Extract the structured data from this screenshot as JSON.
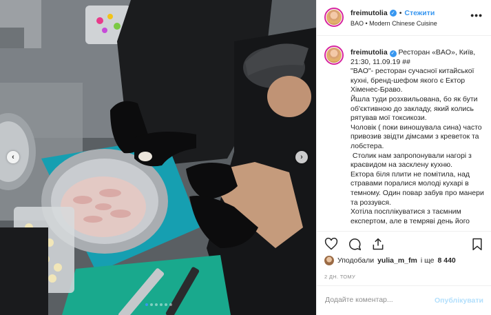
{
  "post": {
    "username": "freimutolia",
    "follow_label": "Стежити",
    "separator": "•",
    "location": "BAO • Modern Chinese Cuisine",
    "more_label": "•••",
    "caption": "Ресторан «BAO», Київ, 21:30, 11.09.19 ##\n\"BAO\"- ресторан сучасної китайської кухні, бренд-шефом якого є Ектор Хіменес-Браво.\nЙшла туди розхвильована, бо як бути об'єктивною до закладу, який колись рятував мої токсикози.\nЧоловік ( поки виношувала сина) часто привозив звідти дімсами з креветок та лобстера.\n Столик нам запропонували нагорі з краєвидом на засклену кухню.\nЕктора біля плити не помітила, над стравами поралися молоді кухарі в темному. Один повар забув про манери та роззувся.\nХотіла посплікуватися з таємним експертом, але в темряві день його",
    "likes_prefix": "Уподобали",
    "likes_user": "yulia_m_fm",
    "likes_middle": "і ще",
    "likes_count": "8 440",
    "time_ago": "2 ДН. ТОМУ",
    "comment_placeholder": "Додайте коментар...",
    "publish_label": "Опублікувати",
    "nav_prev": "‹",
    "nav_next": "›"
  },
  "icons": {
    "like": "heart-icon",
    "comment": "comment-icon",
    "share": "share-icon",
    "save": "bookmark-icon",
    "verified": "verified-icon"
  },
  "colors": {
    "accent": "#3897f0",
    "publish_disabled": "#b2dffc",
    "border": "#efefef",
    "muted": "#8e8e8e"
  },
  "carousel": {
    "slides": 6,
    "active_index": 0
  }
}
